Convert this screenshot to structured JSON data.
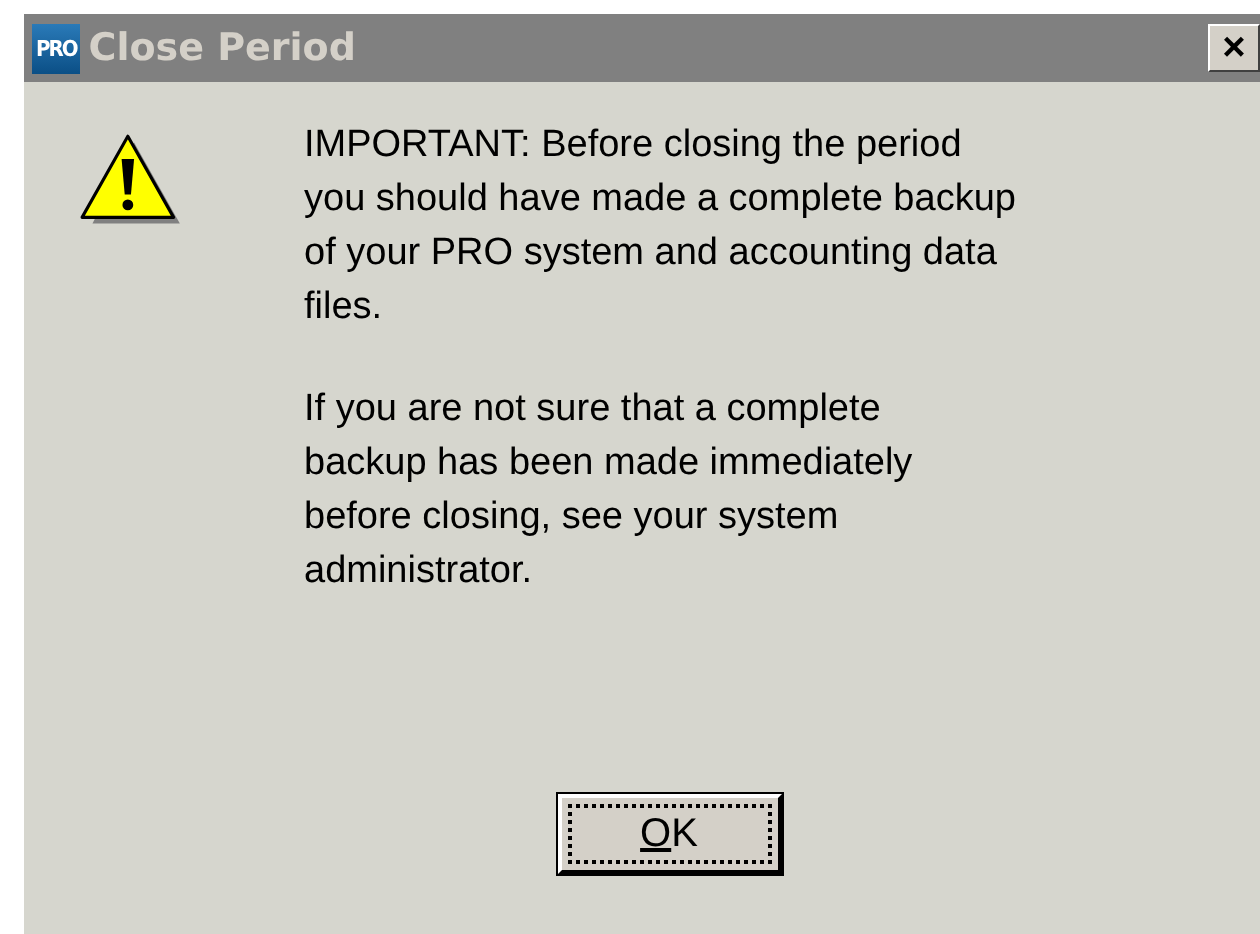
{
  "window": {
    "app_icon_text": "PRO",
    "title": "Close Period",
    "close_button": "×",
    "active": false
  },
  "message": {
    "kind": "warning",
    "paragraphs": [
      [
        "IMPORTANT: Before closing the period",
        "you should have made a complete backup",
        "of your PRO system and accounting data",
        "files."
      ],
      [
        "If you are not sure that a complete",
        "backup has been made immediately",
        "before closing, see your system",
        "administrator."
      ]
    ]
  },
  "buttons": [
    {
      "label": "OK",
      "underline_first": true,
      "focused": true
    }
  ]
}
